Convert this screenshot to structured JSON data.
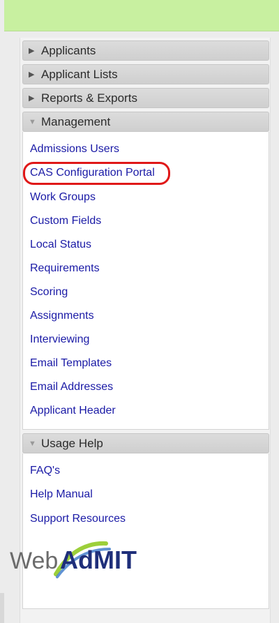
{
  "sidebar": {
    "sections": [
      {
        "label": "Applicants",
        "expanded": false
      },
      {
        "label": "Applicant Lists",
        "expanded": false
      },
      {
        "label": "Reports & Exports",
        "expanded": false
      },
      {
        "label": "Management",
        "expanded": true
      },
      {
        "label": "Usage Help",
        "expanded": true
      }
    ],
    "management_links": [
      "Admissions Users",
      "CAS Configuration Portal",
      "Work Groups",
      "Custom Fields",
      "Local Status",
      "Requirements",
      "Scoring",
      "Assignments",
      "Interviewing",
      "Email Templates",
      "Email Addresses",
      "Applicant Header"
    ],
    "help_links": [
      "FAQ's",
      "Help Manual",
      "Support Resources"
    ],
    "highlighted_link": "CAS Configuration Portal"
  },
  "logo": {
    "text_web": "Web",
    "text_brand": "AdMIT",
    "colors": {
      "web": "#6b6b6b",
      "brand_a": "#1f2f7a",
      "brand_rest": "#2a3a86",
      "swoosh_green": "#9ccf3a",
      "swoosh_blue": "#3a78c9"
    }
  },
  "colors": {
    "top_bar": "#c8f0a0",
    "link": "#1a1aa6",
    "highlight_ring": "#e01818"
  }
}
